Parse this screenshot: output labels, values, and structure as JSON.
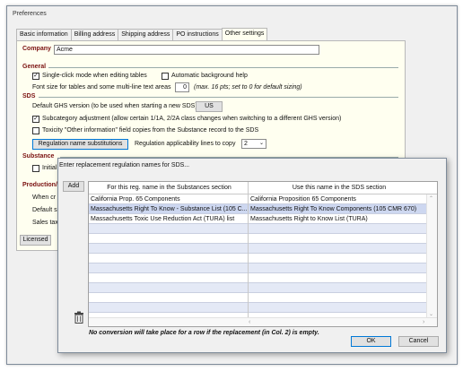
{
  "window": {
    "title": "Preferences"
  },
  "tabs": [
    "Basic information",
    "Billing address",
    "Shipping address",
    "PO instructions",
    "Other settings"
  ],
  "company": {
    "label": "Company",
    "value": "Acme"
  },
  "general": {
    "heading": "General",
    "single_click": "Single-click mode when editing tables",
    "auto_bg_help": "Automatic background help",
    "font_size_label": "Font size for tables and some multi-line text areas",
    "font_size_value": "0",
    "font_size_hint": "(max. 16 pts; set to 0 for default sizing)"
  },
  "sds": {
    "heading": "SDS",
    "default_ghs_label": "Default GHS version (to be used when starting a new SDS)",
    "default_ghs_value": "US",
    "subcategory": "Subcategory adjustment (allow certain 1/1A, 2/2A class changes when switching to a different GHS version)",
    "toxicity": "Toxicity \"Other information\" field copies from the Substance record to the SDS",
    "reg_button": "Regulation name substitutions",
    "reg_lines_label": "Regulation applicability lines to copy",
    "reg_lines_value": "2"
  },
  "substance": {
    "heading": "Substance",
    "initial_label": "Initial"
  },
  "production": {
    "heading": "Production/",
    "when": "When cr",
    "default": "Default s",
    "sales": "Sales tax"
  },
  "licensed_button": "Licensed",
  "dialog": {
    "title": "Enter replacement regulation names for SDS...",
    "add_button": "Add",
    "col1_header": "For this reg. name in the Substances section",
    "col2_header": "Use this name in the SDS section",
    "rows": [
      {
        "col1": "California Prop. 65 Components",
        "col2": "California Proposition 65 Components"
      },
      {
        "col1": "Massachusetts Right To Know - Substance List (105 C...",
        "col2": "Massachusetts Right To Know Components (105 CMR 670)"
      },
      {
        "col1": "Massachusetts Toxic Use Reduction Act (TURA) list",
        "col2": "Massachusetts Right to Know List (TURA)"
      }
    ],
    "note": "No conversion will take place for a row if the replacement (in Col. 2) is empty.",
    "ok_button": "OK",
    "cancel_button": "Cancel"
  }
}
